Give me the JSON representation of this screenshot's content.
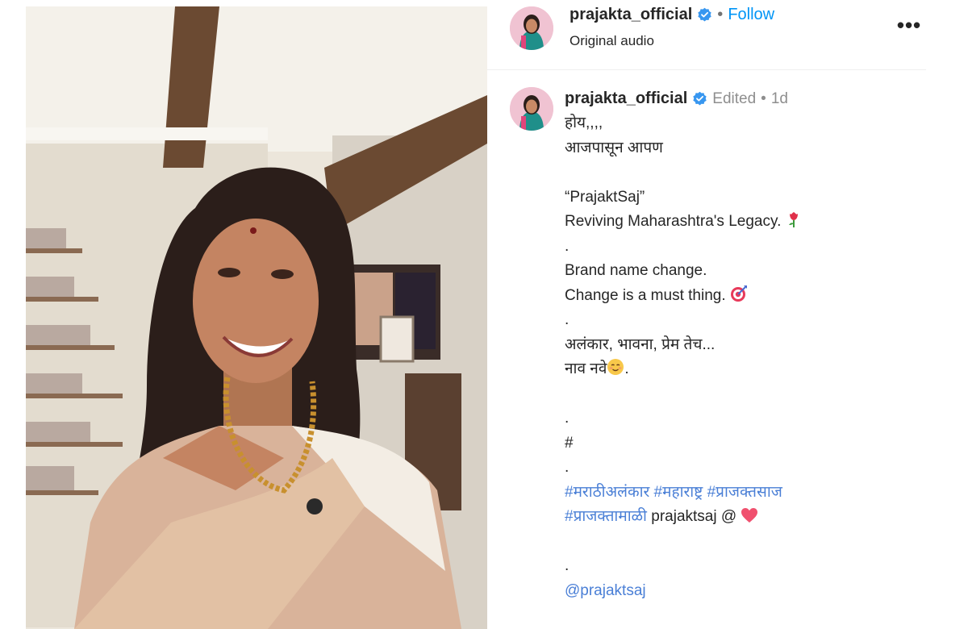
{
  "header": {
    "username": "prajakta_official",
    "separator": "•",
    "follow_label": "Follow",
    "audio": "Original audio",
    "more_label": "•••"
  },
  "post": {
    "username": "prajakta_official",
    "edited": "Edited",
    "separator": "•",
    "age": "1d",
    "caption": {
      "l1": "होय,,,,",
      "l2": "आजपासून आपण",
      "l3": "“PrajaktSaj”",
      "l4": "Reviving Maharashtra's Legacy.",
      "l5": ".",
      "l6": "Brand name change.",
      "l7": "Change is a must thing.",
      "l8": ".",
      "l9": "अलंकार, भावना, प्रेम तेच...",
      "l10": "नाव नवे",
      "l10_end": ".",
      "l11": ".",
      "l12": "#",
      "l13": ".",
      "tag1": "#मराठीअलंकार",
      "tag2": "#महाराष्ट्र",
      "tag3": "#प्राजक्तसाज",
      "tag4": "#प्राजक्तामाळी",
      "l15_text": "prajaktsaj @",
      "l16": ".",
      "mention": "@prajaktsaj"
    }
  },
  "icons": {
    "verified": "verified-badge-icon",
    "rose": "rose-emoji",
    "target": "target-emoji",
    "smile": "relieved-face-emoji",
    "heart": "heart-emoji"
  },
  "colors": {
    "link": "#4a7fd6",
    "follow": "#0095f6",
    "verified": "#3897f0",
    "muted": "#8e8e8e"
  }
}
